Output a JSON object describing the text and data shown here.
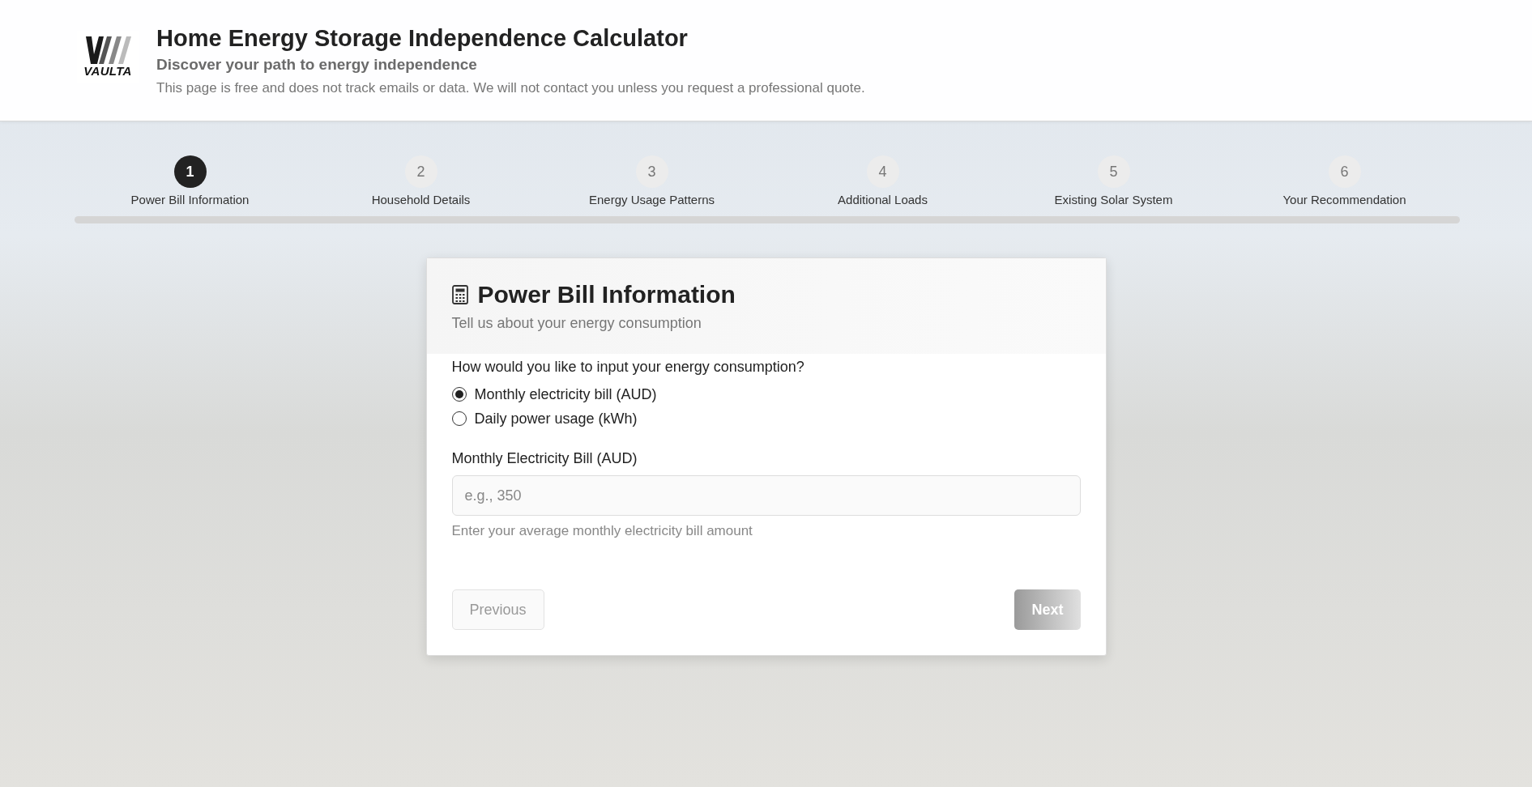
{
  "header": {
    "logo_text": "VAULTA",
    "title": "Home Energy Storage Independence Calculator",
    "subtitle": "Discover your path to energy independence",
    "note": "This page is free and does not track emails or data. We will not contact you unless you request a professional quote."
  },
  "steps": [
    {
      "number": "1",
      "label": "Power Bill Information",
      "selected": true
    },
    {
      "number": "2",
      "label": "Household Details",
      "selected": false
    },
    {
      "number": "3",
      "label": "Energy Usage Patterns",
      "selected": false
    },
    {
      "number": "4",
      "label": "Additional Loads",
      "selected": false
    },
    {
      "number": "5",
      "label": "Existing Solar System",
      "selected": false
    },
    {
      "number": "6",
      "label": "Your Recommendation",
      "selected": false
    }
  ],
  "progress": {
    "level": 0
  },
  "card": {
    "title": "Power Bill Information",
    "subtitle": "Tell us about your energy consumption",
    "question": "How would you like to input your energy consumption?",
    "options": [
      {
        "label": "Monthly electricity bill (AUD)",
        "selected": true
      },
      {
        "label": "Daily power usage (kWh)",
        "selected": false
      }
    ],
    "field": {
      "label": "Monthly Electricity Bill (AUD)",
      "placeholder": "e.g., 350",
      "help": "Enter your average monthly electricity bill amount"
    },
    "buttons": [
      {
        "label": "Previous",
        "kind": "secondary",
        "disabled": true
      },
      {
        "label": "Next",
        "kind": "primary",
        "disabled": false
      }
    ]
  }
}
